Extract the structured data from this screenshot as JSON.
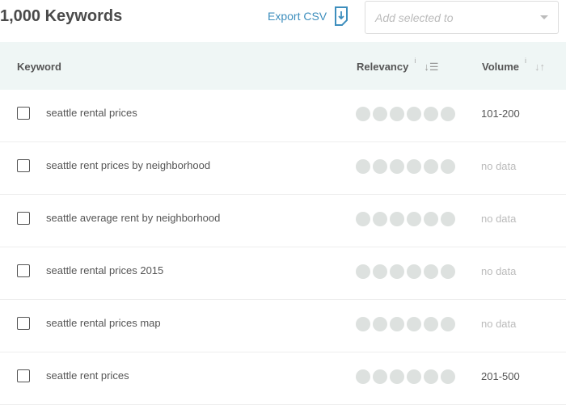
{
  "header": {
    "title": "1,000 Keywords",
    "export_label": "Export CSV",
    "add_placeholder": "Add selected to"
  },
  "table": {
    "columns": {
      "keyword": "Keyword",
      "relevancy": "Relevancy",
      "volume": "Volume",
      "info": "i"
    },
    "rows": [
      {
        "keyword": "seattle rental prices",
        "relevancy": 0,
        "volume": "101-200"
      },
      {
        "keyword": "seattle rent prices by neighborhood",
        "relevancy": 0,
        "volume": "no data"
      },
      {
        "keyword": "seattle average rent by neighborhood",
        "relevancy": 0,
        "volume": "no data"
      },
      {
        "keyword": "seattle rental prices 2015",
        "relevancy": 0,
        "volume": "no data"
      },
      {
        "keyword": "seattle rental prices map",
        "relevancy": 0,
        "volume": "no data"
      },
      {
        "keyword": "seattle rent prices",
        "relevancy": 0,
        "volume": "201-500"
      }
    ]
  },
  "colors": {
    "accent": "#3d8ebd",
    "header_bg": "#eff6f5",
    "dot_empty": "#dde1df"
  }
}
